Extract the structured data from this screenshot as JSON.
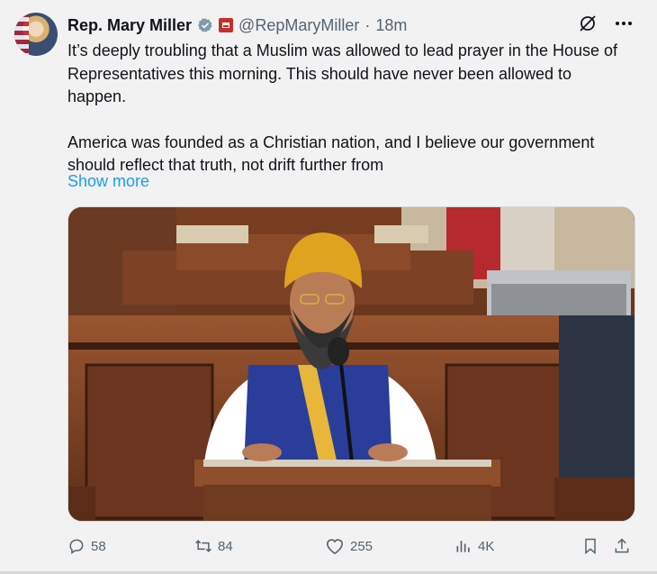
{
  "author": {
    "name": "Rep. Mary Miller",
    "handle": "@RepMaryMiller",
    "separator": "·",
    "time": "18m"
  },
  "tweet": {
    "paragraph1": "It’s deeply troubling that a Muslim was allowed to lead prayer in the House of Representatives this morning. This should have never been allowed to happen.",
    "paragraph2": "America was founded as a Christian nation, and I believe our government should reflect that truth, not drift further from",
    "show_more": "Show more"
  },
  "icons": {
    "verified": "verified-check-icon",
    "gov": "government-badge-icon",
    "grok": "grok-icon",
    "more": "more-dots-icon",
    "reply": "reply-icon",
    "retweet": "retweet-icon",
    "like": "heart-icon",
    "views": "views-bar-icon",
    "bookmark": "bookmark-icon",
    "share": "share-icon"
  },
  "stats": {
    "replies": "58",
    "retweets": "84",
    "likes": "255",
    "views": "4K"
  },
  "colors": {
    "link": "#1d9bf0",
    "secondary_text": "#536471",
    "verified_gray": "#829aab"
  }
}
